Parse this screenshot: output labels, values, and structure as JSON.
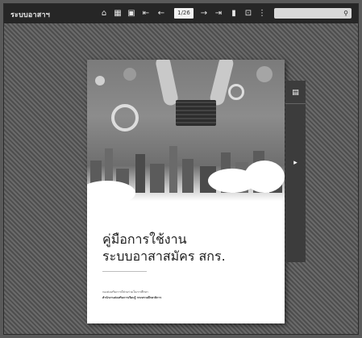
{
  "app": {
    "title": "ระบบอาสาฯ"
  },
  "toolbar": {
    "buttons": [
      {
        "name": "home-icon",
        "glyph": "⌂"
      },
      {
        "name": "grid-icon",
        "glyph": "▦"
      },
      {
        "name": "book-icon",
        "glyph": "▣"
      },
      {
        "name": "first-page-icon",
        "glyph": "⇤"
      },
      {
        "name": "prev-page-icon",
        "glyph": "←"
      },
      {
        "name": "next-page-icon",
        "glyph": "→"
      },
      {
        "name": "last-page-icon",
        "glyph": "⇥"
      },
      {
        "name": "bookmark-icon",
        "glyph": "▮"
      },
      {
        "name": "fullscreen-icon",
        "glyph": "⊡"
      },
      {
        "name": "more-icon",
        "glyph": "⋮"
      }
    ],
    "page_indicator": "1/26",
    "search_placeholder": "",
    "search_icon": "search-icon"
  },
  "cover": {
    "title_line1": "คู่มือการใช้งาน",
    "title_line2": "ระบบอาสาสมัคร สกร.",
    "sub_line1": "กองส่งเสริมการมีส่วนร่วมในการศึกษา",
    "sub_line2": "สำนักงานส่งเสริมการเรียนรู้ กระทรวงศึกษาธิการ"
  },
  "side_tab": {
    "top_icon": "pages-icon",
    "top_glyph": "▤",
    "bottom_icon": "expand-arrow-icon",
    "bottom_glyph": "▸"
  },
  "colors": {
    "toolbar_bg": "#262626",
    "viewer_bg": "#5a5a5a",
    "cover_bg": "#ffffff",
    "title_text": "#1e1e1e"
  }
}
